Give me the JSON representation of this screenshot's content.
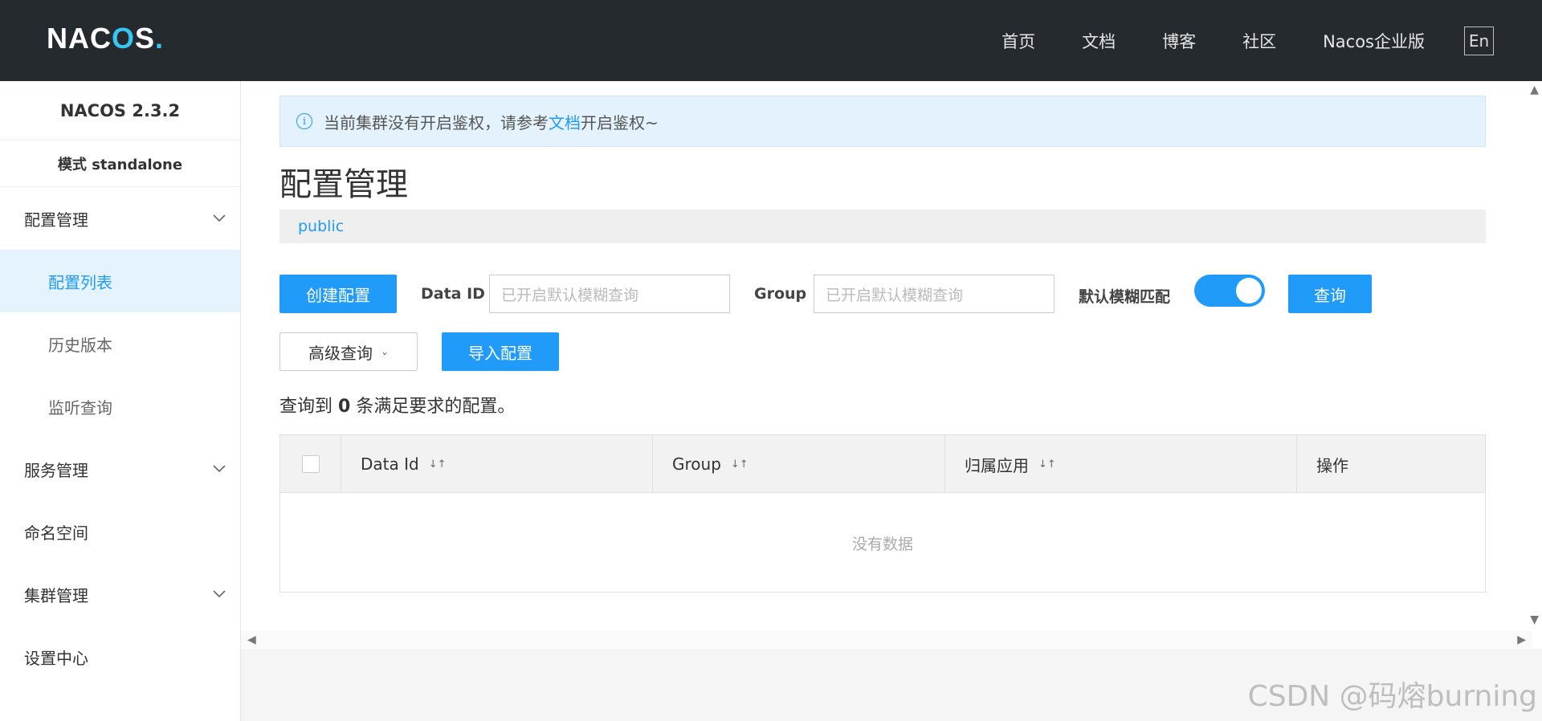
{
  "header": {
    "logo_text": "NACOS.",
    "nav": [
      "首页",
      "文档",
      "博客",
      "社区",
      "Nacos企业版"
    ],
    "lang_button": "En"
  },
  "sidebar": {
    "version": "NACOS 2.3.2",
    "mode": "模式 standalone",
    "items": [
      {
        "label": "配置管理",
        "expandable": true
      },
      {
        "label": "配置列表",
        "active": true,
        "sub": true
      },
      {
        "label": "历史版本",
        "sub": true
      },
      {
        "label": "监听查询",
        "sub": true
      },
      {
        "label": "服务管理",
        "expandable": true
      },
      {
        "label": "命名空间",
        "expandable": false
      },
      {
        "label": "集群管理",
        "expandable": true
      },
      {
        "label": "设置中心",
        "expandable": false
      }
    ]
  },
  "notice": {
    "text_before": "当前集群没有开启鉴权，请参考",
    "link": "文档",
    "text_after": "开启鉴权~"
  },
  "page_title": "配置管理",
  "namespace": "public",
  "toolbar": {
    "create_label": "创建配置",
    "data_id_label": "Data ID",
    "data_id_placeholder": "已开启默认模糊查询",
    "group_label": "Group",
    "group_placeholder": "已开启默认模糊查询",
    "fuzzy_label": "默认模糊匹配",
    "fuzzy_on": true,
    "query_label": "查询",
    "advanced_label": "高级查询",
    "import_label": "导入配置"
  },
  "result": {
    "prefix": "查询到",
    "count": "0",
    "suffix": "条满足要求的配置。"
  },
  "table": {
    "columns": [
      "Data Id",
      "Group",
      "归属应用",
      "操作"
    ],
    "empty_text": "没有数据"
  },
  "watermark": "CSDN @码熔burning",
  "colors": {
    "header_bg": "#252a2f",
    "accent": "#209bfa",
    "active_bg": "#e5f3ff"
  }
}
